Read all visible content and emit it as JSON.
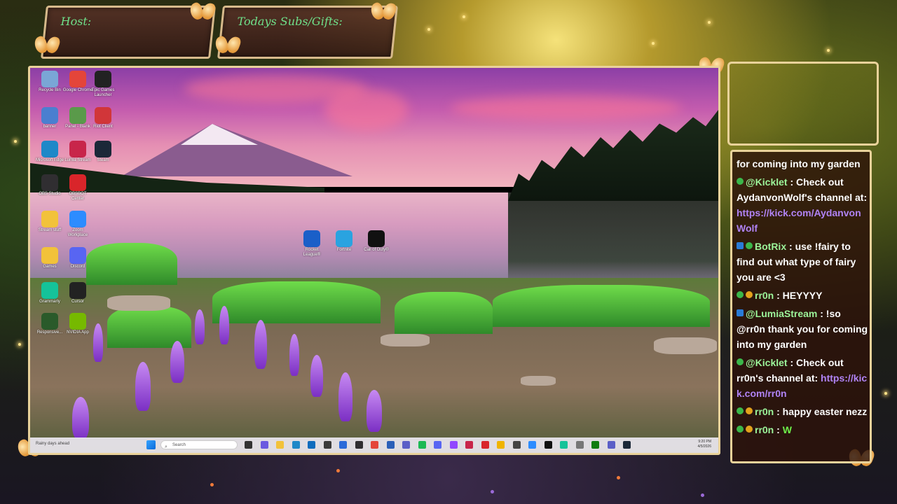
{
  "overlay": {
    "host_label": "Host:",
    "subs_label": "Todays Subs/Gifts:"
  },
  "desktop_icons": [
    {
      "label": "Recycle Bin",
      "icon": "recycle-bin-icon",
      "color": "#7aa6d6"
    },
    {
      "label": "Google Chrome",
      "icon": "chrome-icon",
      "color": "#e4453a"
    },
    {
      "label": "Epic Games Launcher",
      "icon": "epic-games-icon",
      "color": "#222222"
    },
    {
      "label": "banner",
      "icon": "image-file-icon",
      "color": "#4a7fd0"
    },
    {
      "label": "Panel - Blank",
      "icon": "image-file-icon",
      "color": "#5a9a4a"
    },
    {
      "label": "Riot Client",
      "icon": "riot-icon",
      "color": "#d13639"
    },
    {
      "label": "Microsoft Edge",
      "icon": "edge-icon",
      "color": "#1e88c8"
    },
    {
      "label": "Lumia Stream",
      "icon": "lumia-icon",
      "color": "#c8254a"
    },
    {
      "label": "Steam",
      "icon": "steam-icon",
      "color": "#1b2838"
    },
    {
      "label": "OBS Studio",
      "icon": "obs-icon",
      "color": "#302e31"
    },
    {
      "label": "OBSBOT Center",
      "icon": "obsbot-icon",
      "color": "#d9252a"
    },
    {
      "label": "Stream stuff",
      "icon": "folder-icon",
      "color": "#f2c23a"
    },
    {
      "label": "Zoom Workplace",
      "icon": "zoom-icon",
      "color": "#2d8cff"
    },
    {
      "label": "Games",
      "icon": "folder-icon",
      "color": "#f2c23a"
    },
    {
      "label": "Discord",
      "icon": "discord-icon",
      "color": "#5865f2"
    },
    {
      "label": "Grammarly",
      "icon": "grammarly-icon",
      "color": "#15c39a"
    },
    {
      "label": "Cursor",
      "icon": "cursor-icon",
      "color": "#222222"
    },
    {
      "label": "Responsive...",
      "icon": "responsive-icon",
      "color": "#2a5a2a"
    },
    {
      "label": "NVIDIA App",
      "icon": "nvidia-icon",
      "color": "#76b900"
    }
  ],
  "game_icons": [
    {
      "label": "Rocket League®",
      "icon": "rocket-league-icon",
      "color": "#1a5fc8"
    },
    {
      "label": "Fortnite",
      "icon": "fortnite-icon",
      "color": "#2aa3e0"
    },
    {
      "label": "Call of Duty®",
      "icon": "call-of-duty-icon",
      "color": "#111111"
    }
  ],
  "taskbar": {
    "weather": "Rainy days ahead",
    "search_placeholder": "Search",
    "time": "9:20 PM",
    "date": "4/5/2026",
    "apps": [
      {
        "name": "task-view-icon",
        "color": "#333333"
      },
      {
        "name": "copilot-icon",
        "color": "#6a5ae0"
      },
      {
        "name": "file-explorer-icon",
        "color": "#f2c23a"
      },
      {
        "name": "edge-icon",
        "color": "#1e88c8"
      },
      {
        "name": "outlook-icon",
        "color": "#0f6cbd"
      },
      {
        "name": "store-icon",
        "color": "#3a3a3a"
      },
      {
        "name": "capture-icon",
        "color": "#2a6ad9"
      },
      {
        "name": "obs-icon",
        "color": "#302e31"
      },
      {
        "name": "chrome-icon",
        "color": "#e4453a"
      },
      {
        "name": "word-icon",
        "color": "#2b5fb8"
      },
      {
        "name": "teams-icon",
        "color": "#5b5fc7"
      },
      {
        "name": "spotify-icon",
        "color": "#1db954"
      },
      {
        "name": "discord-icon",
        "color": "#5865f2"
      },
      {
        "name": "twitch-icon",
        "color": "#9146ff"
      },
      {
        "name": "lumia-icon",
        "color": "#c8254a"
      },
      {
        "name": "obsbot-icon",
        "color": "#d9252a"
      },
      {
        "name": "notes-icon",
        "color": "#f0b400"
      },
      {
        "name": "app-icon",
        "color": "#444444"
      },
      {
        "name": "zoom-icon",
        "color": "#2d8cff"
      },
      {
        "name": "chatgpt-icon",
        "color": "#111111"
      },
      {
        "name": "grammarly-icon",
        "color": "#15c39a"
      },
      {
        "name": "app-icon",
        "color": "#777777"
      },
      {
        "name": "xbox-icon",
        "color": "#107c10"
      },
      {
        "name": "teams-icon",
        "color": "#5b5fc7"
      },
      {
        "name": "steam-icon",
        "color": "#1b2838"
      }
    ]
  },
  "chat": [
    {
      "badges": [],
      "user": "",
      "text": "for coming into my garden"
    },
    {
      "badges": [
        "check"
      ],
      "user": "@Kicklet",
      "text": " : Check out AydanvonWolf's channel at: ",
      "link": "https://kick.com/AydanvonWolf"
    },
    {
      "badges": [
        "bot",
        "check"
      ],
      "user": "BotRix",
      "text": " : use !fairy to find out what type of fairy you are <3"
    },
    {
      "badges": [
        "check",
        "gold"
      ],
      "user": "rr0n",
      "text": " : HEYYYY"
    },
    {
      "badges": [
        "bot"
      ],
      "user": "@LumiaStream",
      "text": " : !so @rr0n thank you for coming into my garden"
    },
    {
      "badges": [
        "check"
      ],
      "user": "@Kicklet",
      "text": " : Check out rr0n's channel at: ",
      "link": "https://kick.com/rr0n"
    },
    {
      "badges": [
        "check",
        "gold"
      ],
      "user": "rr0n",
      "text": " : happy easter nezz"
    },
    {
      "badges": [
        "check",
        "gold"
      ],
      "user": "rr0n",
      "text": " : ",
      "emote": "W"
    }
  ]
}
